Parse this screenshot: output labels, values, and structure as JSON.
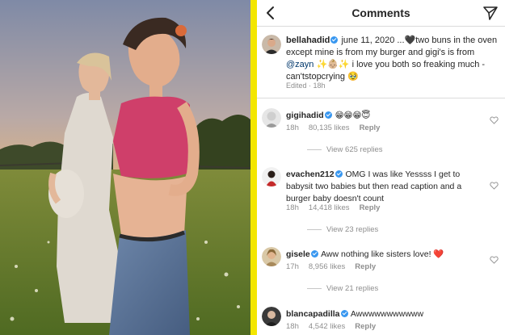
{
  "header": {
    "title": "Comments"
  },
  "caption": {
    "username": "bellahadid",
    "text_part1": " june 11, 2020 ...",
    "emoji_heart": "🖤",
    "text_part2": "two buns in the oven except mine is from my burger and gigi's is from ",
    "mention": "@zayn",
    "emoji_sparkle_baby": " ✨👶🏼✨ ",
    "text_part3": "i love you both so freaking much -can'tstopcrying ",
    "emoji_end": "🥹",
    "edited": "Edited · 18h"
  },
  "comments": [
    {
      "username": "gigihadid",
      "text": "😁😁😁😇",
      "time": "18h",
      "likes": "80,135 likes",
      "reply": "Reply",
      "view_replies": "View 625 replies"
    },
    {
      "username": "evachen212",
      "text": " OMG I was like Yessss I get to babysit two babies but then read caption and a burger baby doesn't count",
      "time": "18h",
      "likes": "14,418 likes",
      "reply": "Reply",
      "view_replies": "View 23 replies"
    },
    {
      "username": "gisele",
      "text": " Aww nothing like sisters love! ❤️",
      "time": "17h",
      "likes": "8,956 likes",
      "reply": "Reply",
      "view_replies": "View 21 replies"
    },
    {
      "username": "blancapadilla",
      "text": " Awwwwwwwwwww",
      "time": "18h",
      "likes": "4,542 likes",
      "reply": "Reply"
    }
  ],
  "icons": {
    "back": "chevron-left-icon",
    "send": "paper-plane-icon",
    "like": "heart-outline-icon",
    "verified": "verified-badge-icon"
  },
  "colors": {
    "divider": "#f3e600",
    "verified": "#3897f0",
    "mention": "#00376b",
    "muted": "#8e8e8e"
  }
}
